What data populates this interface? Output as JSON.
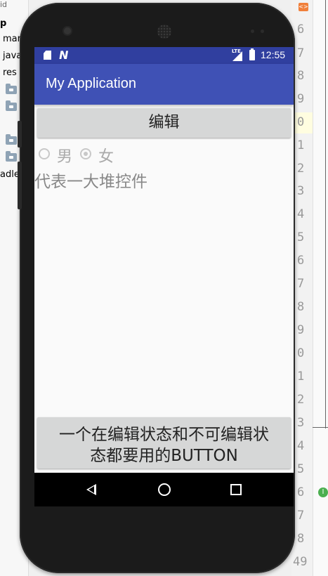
{
  "ide": {
    "top_label": "id",
    "tree": {
      "project_label": "p",
      "items": [
        "mar",
        "java",
        "res"
      ],
      "gradle_label": "adle"
    },
    "gutter_badge": "<>",
    "line_numbers": [
      "6",
      "7",
      "8",
      "9",
      "0",
      "1",
      "2",
      "3",
      "4",
      "5",
      "6",
      "7",
      "8",
      "9",
      "0",
      "1",
      "2",
      "3",
      "4",
      "5",
      "6",
      "7",
      "8",
      "49"
    ],
    "marker": "I"
  },
  "status_bar": {
    "time": "12:55",
    "network_label": "LTE",
    "icons": [
      "sd-card-icon",
      "n-notification-icon",
      "signal-icon",
      "battery-icon"
    ]
  },
  "app": {
    "title": "My Application",
    "edit_button_label": "编辑",
    "radio_options": [
      {
        "label": "男",
        "checked": false
      },
      {
        "label": "女",
        "checked": true
      }
    ],
    "placeholder_text": "代表一大堆控件",
    "bottom_button_label_line1": "一个在编辑状态和不可编辑状",
    "bottom_button_label_line2": "态都要用的BUTTON"
  },
  "nav_bar": {
    "icons": [
      "back-icon",
      "home-icon",
      "recents-icon"
    ]
  }
}
